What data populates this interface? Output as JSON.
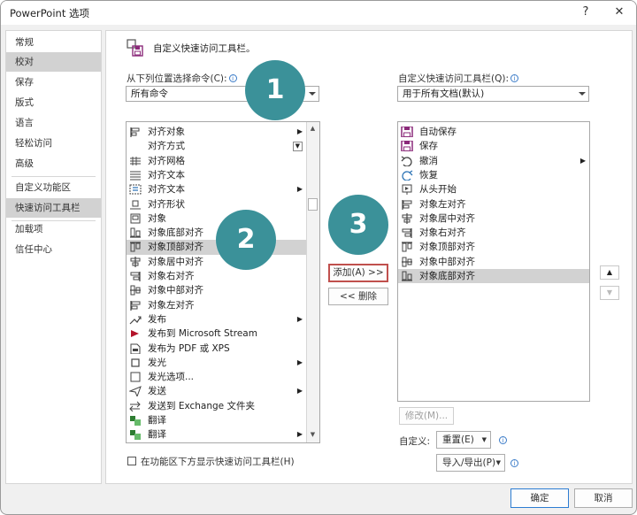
{
  "window": {
    "title": "PowerPoint 选项",
    "help_label": "?",
    "close_label": "✕"
  },
  "sidebar": {
    "items": [
      {
        "label": "常规"
      },
      {
        "label": "校对"
      },
      {
        "label": "保存"
      },
      {
        "label": "版式"
      },
      {
        "label": "语言"
      },
      {
        "label": "轻松访问"
      },
      {
        "label": "高级"
      },
      {
        "label": "自定义功能区"
      },
      {
        "label": "快速访问工具栏"
      },
      {
        "label": "加载项"
      },
      {
        "label": "信任中心"
      }
    ],
    "selected": "快速访问工具栏"
  },
  "header": {
    "title": "自定义快速访问工具栏。"
  },
  "left": {
    "choose_label": "从下列位置选择命令(C):",
    "choose_value": "所有命令",
    "commands": [
      {
        "label": "对齐对象",
        "icon": "align-object-icon",
        "submenu": true
      },
      {
        "label": "对齐方式",
        "icon": "none",
        "dropdown": true
      },
      {
        "label": "对齐网格",
        "icon": "align-grid-icon"
      },
      {
        "label": "对齐文本",
        "icon": "align-text-icon"
      },
      {
        "label": "对齐文本",
        "icon": "align-text-vertical-icon",
        "submenu": true
      },
      {
        "label": "对齐形状",
        "icon": "align-shape-icon"
      },
      {
        "label": "对象",
        "icon": "object-icon"
      },
      {
        "label": "对象底部对齐",
        "icon": "align-bottom-icon"
      },
      {
        "label": "对象顶部对齐",
        "icon": "align-top-icon"
      },
      {
        "label": "对象居中对齐",
        "icon": "align-center-icon"
      },
      {
        "label": "对象右对齐",
        "icon": "align-right-icon"
      },
      {
        "label": "对象中部对齐",
        "icon": "align-middle-icon"
      },
      {
        "label": "对象左对齐",
        "icon": "align-left-icon"
      },
      {
        "label": "发布",
        "icon": "publish-icon",
        "submenu": true
      },
      {
        "label": "发布到 Microsoft Stream",
        "icon": "stream-icon"
      },
      {
        "label": "发布为 PDF 或 XPS",
        "icon": "pdf-icon"
      },
      {
        "label": "发光",
        "icon": "glow-icon",
        "submenu": true
      },
      {
        "label": "发光选项...",
        "icon": "glow-options-icon"
      },
      {
        "label": "发送",
        "icon": "send-icon",
        "submenu": true
      },
      {
        "label": "发送到 Exchange 文件夹",
        "icon": "exchange-icon"
      },
      {
        "label": "翻译",
        "icon": "translate-icon"
      },
      {
        "label": "翻译",
        "icon": "translate-icon",
        "submenu": true
      }
    ],
    "selected_index": 8,
    "show_below_label": "在功能区下方显示快速访问工具栏(H)"
  },
  "middle": {
    "add_label": "添加(A) >>",
    "remove_label": "<< 删除"
  },
  "right": {
    "customize_label": "自定义快速访问工具栏(Q):",
    "customize_value": "用于所有文档(默认)",
    "items": [
      {
        "label": "自动保存",
        "icon": "autosave-icon"
      },
      {
        "label": "保存",
        "icon": "save-icon"
      },
      {
        "label": "撤消",
        "icon": "undo-icon",
        "submenu": true
      },
      {
        "label": "恢复",
        "icon": "redo-icon"
      },
      {
        "label": "从头开始",
        "icon": "slideshow-start-icon"
      },
      {
        "label": "对象左对齐",
        "icon": "align-left-icon"
      },
      {
        "label": "对象居中对齐",
        "icon": "align-center-icon"
      },
      {
        "label": "对象右对齐",
        "icon": "align-right-icon"
      },
      {
        "label": "对象顶部对齐",
        "icon": "align-top-icon"
      },
      {
        "label": "对象中部对齐",
        "icon": "align-middle-icon"
      },
      {
        "label": "对象底部对齐",
        "icon": "align-bottom-icon"
      }
    ],
    "selected_index": 10,
    "modify_label": "修改(M)...",
    "custom_label": "自定义:",
    "reset_label": "重置(E)",
    "import_export_label": "导入/导出(P)"
  },
  "footer": {
    "ok_label": "确定",
    "cancel_label": "取消"
  },
  "badges": [
    "1",
    "2",
    "3"
  ],
  "colors": {
    "badge": "#3b9199",
    "highlight_border": "#c0504d",
    "selection": "#d2d2d2",
    "save_icon": "#8b2a7a"
  }
}
